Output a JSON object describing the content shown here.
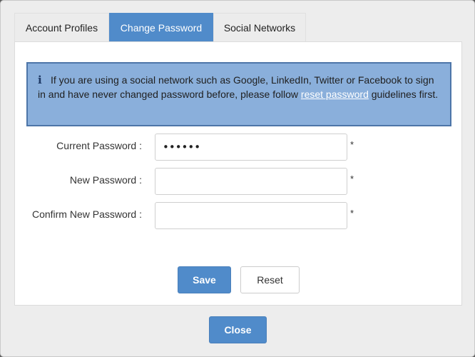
{
  "tabs": [
    {
      "label": "Account Profiles",
      "active": false
    },
    {
      "label": "Change Password",
      "active": true
    },
    {
      "label": "Social Networks",
      "active": false
    }
  ],
  "info": {
    "icon": "info-icon",
    "icon_glyph": "i",
    "text_before": "If you are using a social network such as Google, LinkedIn, Twitter or Facebook to sign in and have never changed password before, please follow ",
    "link_text": "reset password",
    "text_after": " guidelines first."
  },
  "form": {
    "current_password": {
      "label": "Current Password :",
      "value": "••••••",
      "required_mark": "*"
    },
    "new_password": {
      "label": "New Password :",
      "value": "",
      "required_mark": "*"
    },
    "confirm_password": {
      "label": "Confirm New Password :",
      "value": "",
      "required_mark": "*"
    }
  },
  "buttons": {
    "save": "Save",
    "reset": "Reset",
    "close": "Close"
  },
  "colors": {
    "accent": "#508bca",
    "info_bg": "#8aafdb",
    "info_border": "#4d75a8"
  }
}
